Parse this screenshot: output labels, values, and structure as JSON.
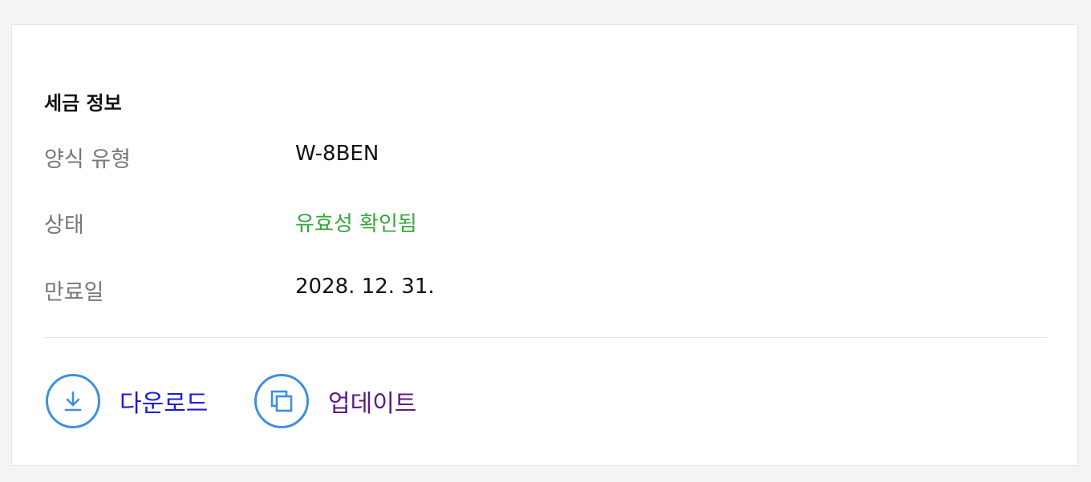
{
  "section": {
    "title": "세금 정보"
  },
  "rows": [
    {
      "label": "양식 유형",
      "value": "W-8BEN"
    },
    {
      "label": "상태",
      "value": "유효성 확인됨"
    },
    {
      "label": "만료일",
      "value": "2028. 12. 31."
    }
  ],
  "actions": {
    "download": {
      "label": "다운로드",
      "icon": "download-icon"
    },
    "update": {
      "label": "업데이트",
      "icon": "copy-icon"
    }
  },
  "colors": {
    "status": "#37a53c",
    "icon": "#3d8fe3",
    "download_link": "#1a1adc",
    "update_link": "#5a1a86"
  }
}
